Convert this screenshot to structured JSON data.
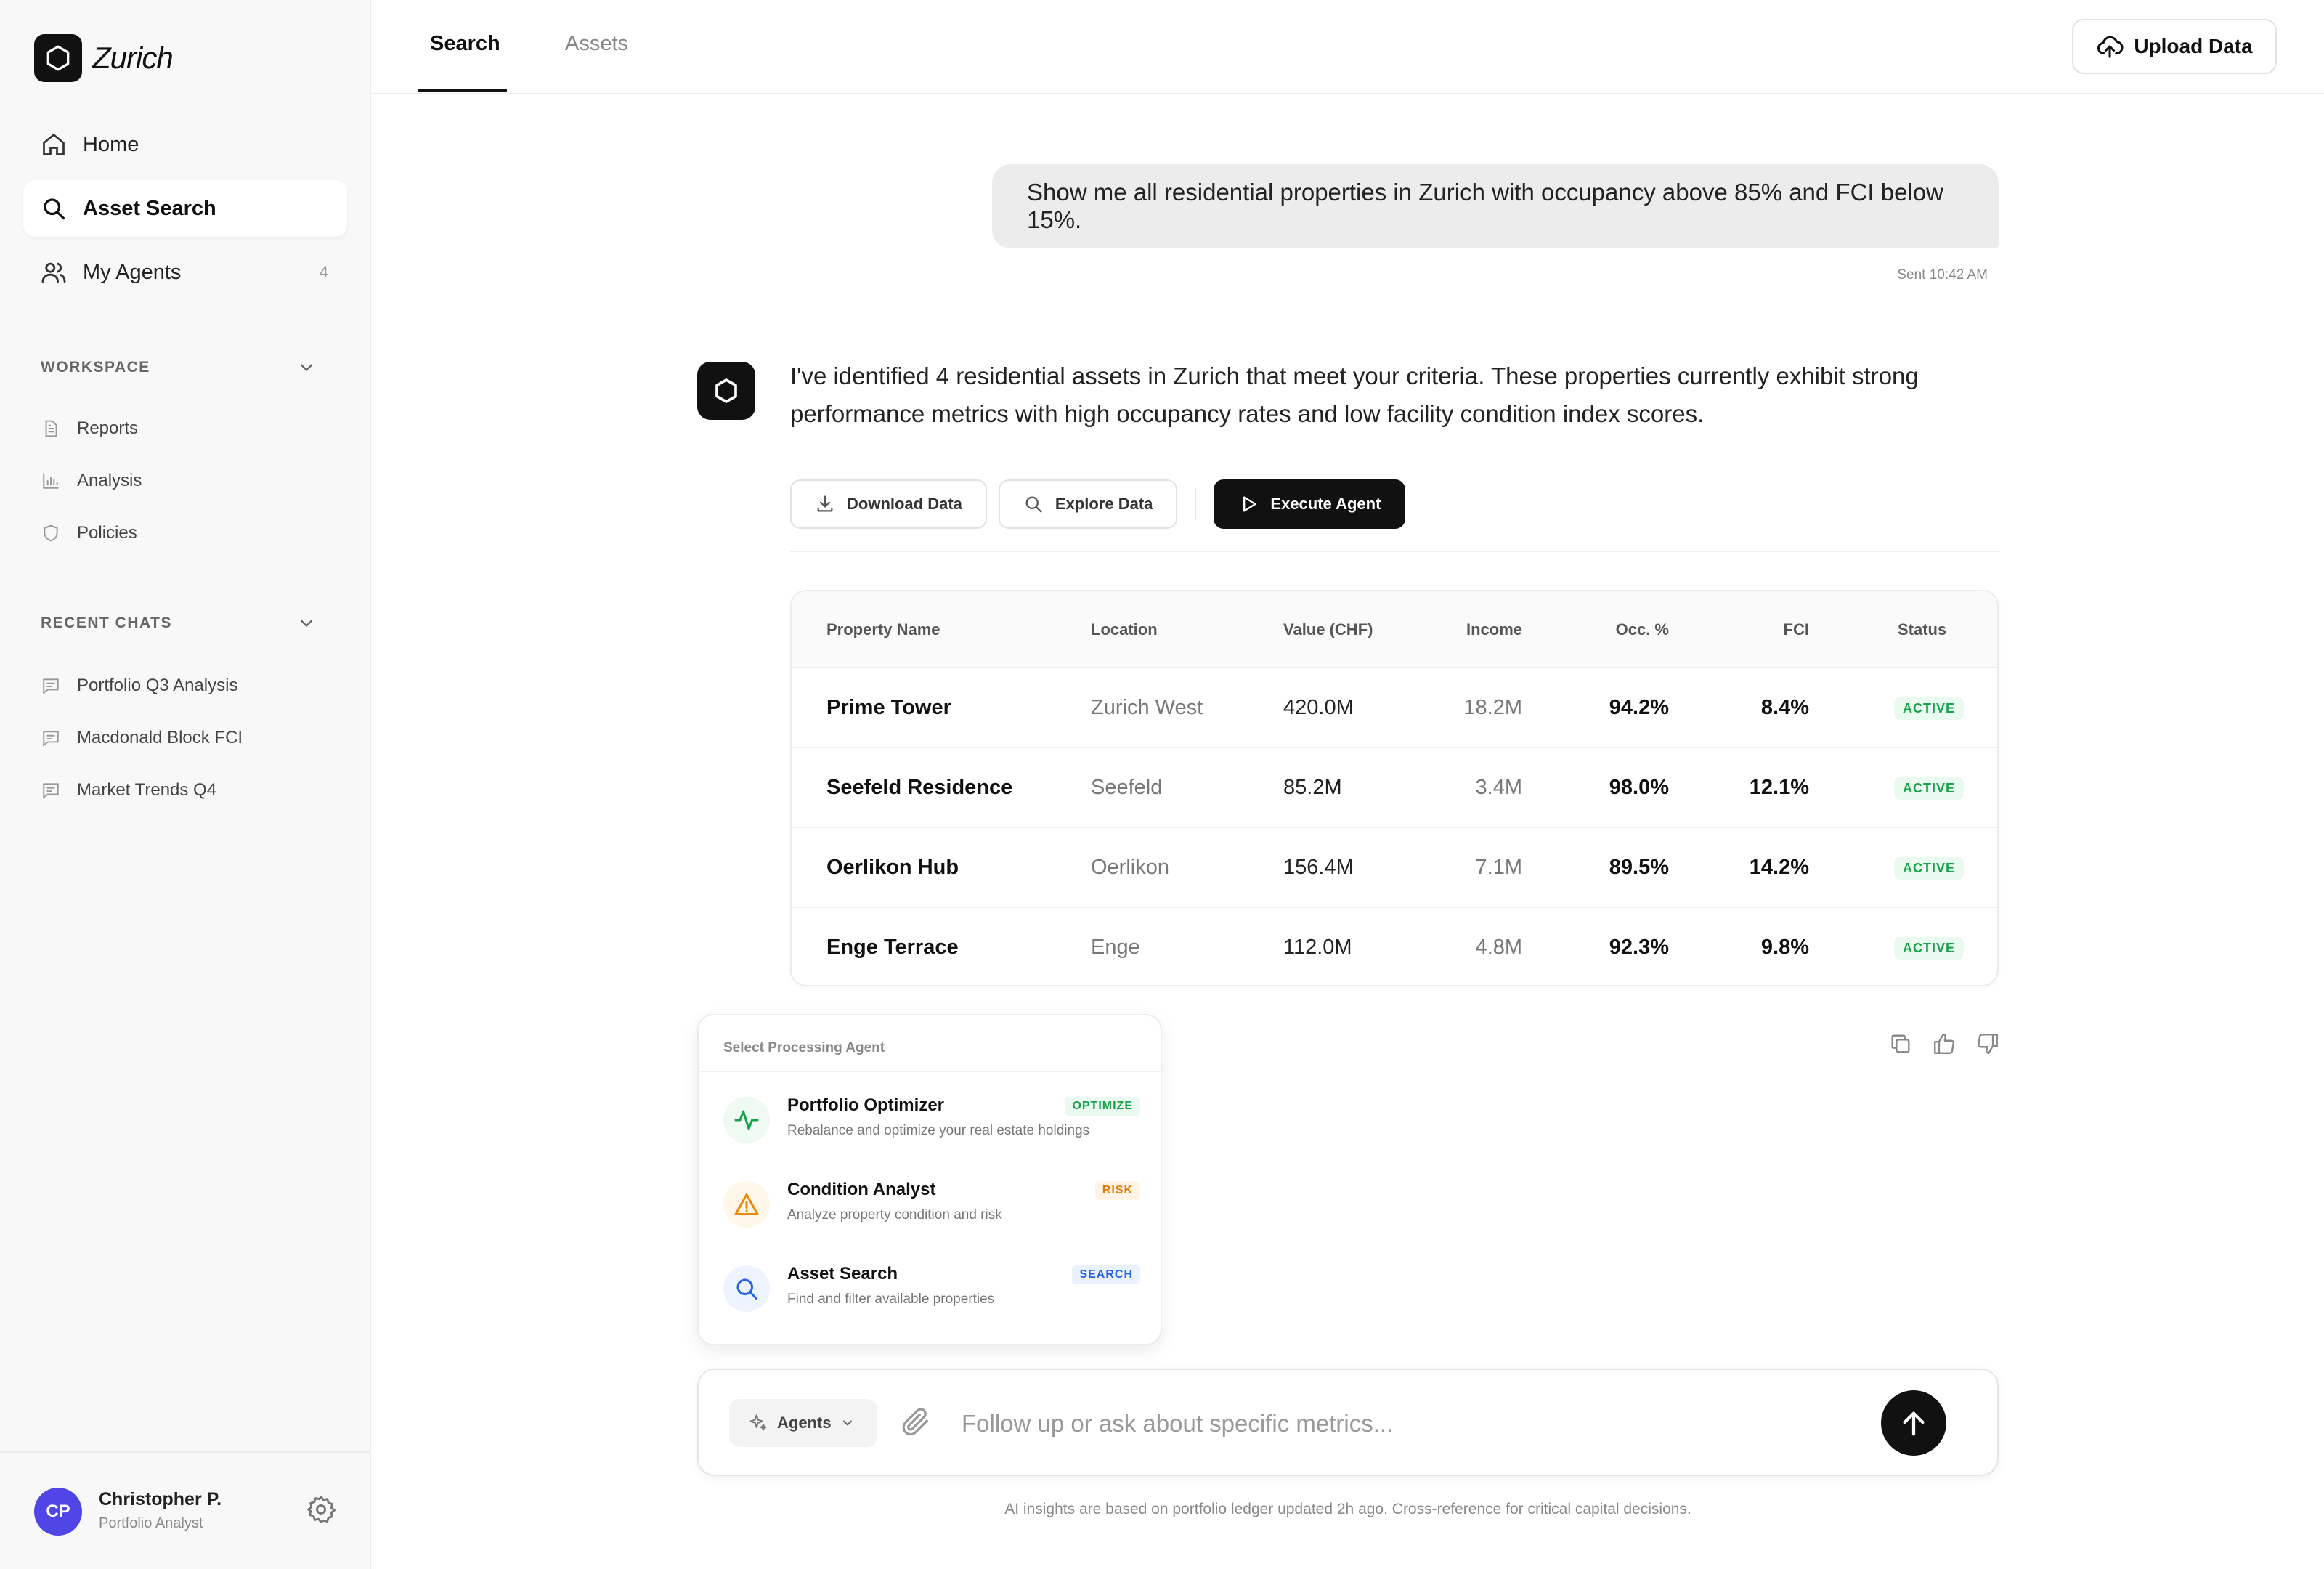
{
  "brand": {
    "name": "Zurich"
  },
  "nav": {
    "items": [
      {
        "label": "Home",
        "icon": "home-icon"
      },
      {
        "label": "Asset Search",
        "icon": "search-icon"
      },
      {
        "label": "My Agents",
        "icon": "users-icon",
        "count": "4"
      }
    ]
  },
  "workspace": {
    "title": "WORKSPACE",
    "items": [
      {
        "label": "Reports",
        "icon": "document-icon"
      },
      {
        "label": "Analysis",
        "icon": "bar-chart-icon"
      },
      {
        "label": "Policies",
        "icon": "shield-icon"
      }
    ]
  },
  "recent": {
    "title": "RECENT CHATS",
    "items": [
      {
        "label": "Portfolio Q3 Analysis",
        "icon": "chat-icon"
      },
      {
        "label": "Macdonald Block FCI",
        "icon": "chat-icon"
      },
      {
        "label": "Market Trends Q4",
        "icon": "chat-icon"
      }
    ]
  },
  "user": {
    "initials": "CP",
    "name": "Christopher P.",
    "role": "Portfolio Analyst"
  },
  "tabs": [
    {
      "label": "Search"
    },
    {
      "label": "Assets"
    }
  ],
  "upload": {
    "label": "Upload Data"
  },
  "chat": {
    "user_message": "Show me all residential properties in Zurich with occupancy above 85% and FCI below 15%.",
    "sent": "Sent 10:42 AM",
    "bot_message": "I've identified 4 residential assets in Zurich that meet your criteria. These properties currently exhibit strong performance metrics with high occupancy rates and low facility condition index scores."
  },
  "actions": {
    "download": "Download Data",
    "explore": "Explore Data",
    "execute": "Execute Agent"
  },
  "table": {
    "headers": [
      "Property Name",
      "Location",
      "Value (CHF)",
      "Income",
      "Occ. %",
      "FCI",
      "Status"
    ],
    "rows": [
      {
        "name": "Prime Tower",
        "location": "Zurich West",
        "value": "420.0M",
        "income": "18.2M",
        "occ": "94.2%",
        "fci": "8.4%",
        "status": "ACTIVE"
      },
      {
        "name": "Seefeld Residence",
        "location": "Seefeld",
        "value": "85.2M",
        "income": "3.4M",
        "occ": "98.0%",
        "fci": "12.1%",
        "status": "ACTIVE"
      },
      {
        "name": "Oerlikon Hub",
        "location": "Oerlikon",
        "value": "156.4M",
        "income": "7.1M",
        "occ": "89.5%",
        "fci": "14.2%",
        "status": "ACTIVE"
      },
      {
        "name": "Enge Terrace",
        "location": "Enge",
        "value": "112.0M",
        "income": "4.8M",
        "occ": "92.3%",
        "fci": "9.8%",
        "status": "ACTIVE"
      }
    ]
  },
  "agent_picker": {
    "title": "Select Processing Agent",
    "agents": [
      {
        "name": "Portfolio Optimizer",
        "desc": "Rebalance and optimize your real estate holdings",
        "tag": "OPTIMIZE",
        "icon": "activity-icon",
        "color": "#16a34a"
      },
      {
        "name": "Condition Analyst",
        "desc": "Analyze property condition and risk",
        "tag": "RISK",
        "icon": "warning-icon",
        "color": "#ea8a0c"
      },
      {
        "name": "Asset Search",
        "desc": "Find and filter available properties",
        "tag": "SEARCH",
        "icon": "search-icon",
        "color": "#2563eb"
      }
    ]
  },
  "composer": {
    "agents_label": "Agents",
    "placeholder": "Follow up or ask about specific metrics..."
  },
  "disclaimer": "AI insights are based on portfolio ledger updated 2h ago. Cross-reference for critical capital decisions."
}
